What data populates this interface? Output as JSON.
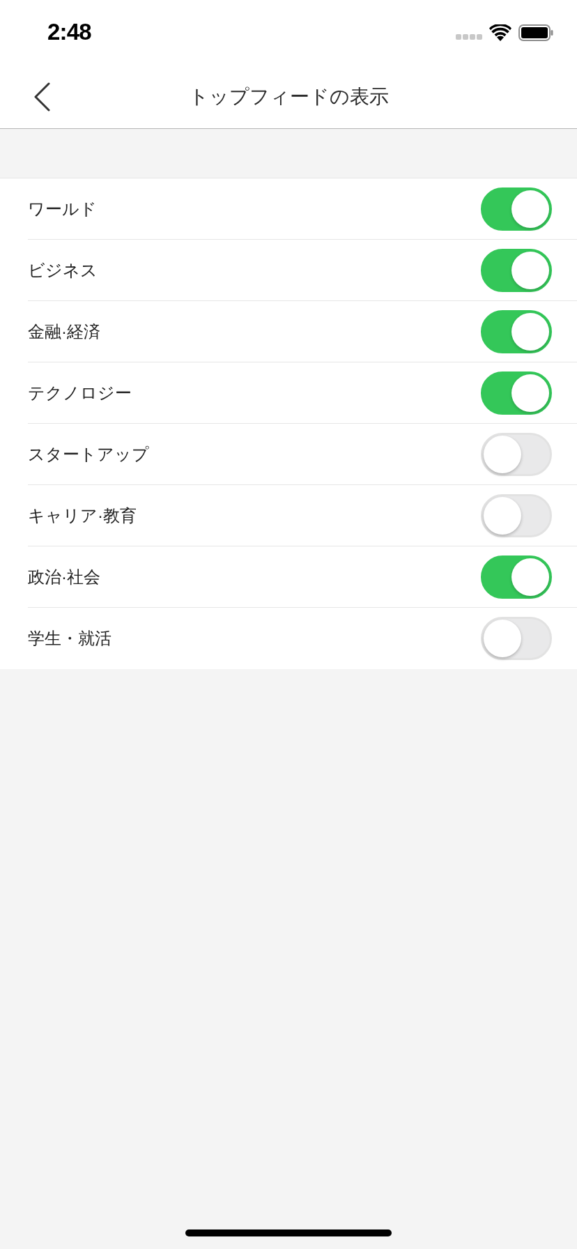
{
  "status_bar": {
    "time": "2:48"
  },
  "nav": {
    "title": "トップフィードの表示"
  },
  "settings": [
    {
      "label": "ワールド",
      "on": true
    },
    {
      "label": "ビジネス",
      "on": true
    },
    {
      "label": "金融·経済",
      "on": true
    },
    {
      "label": "テクノロジー",
      "on": true
    },
    {
      "label": "スタートアップ",
      "on": false
    },
    {
      "label": "キャリア·教育",
      "on": false
    },
    {
      "label": "政治·社会",
      "on": true
    },
    {
      "label": "学生・就活",
      "on": false
    }
  ]
}
